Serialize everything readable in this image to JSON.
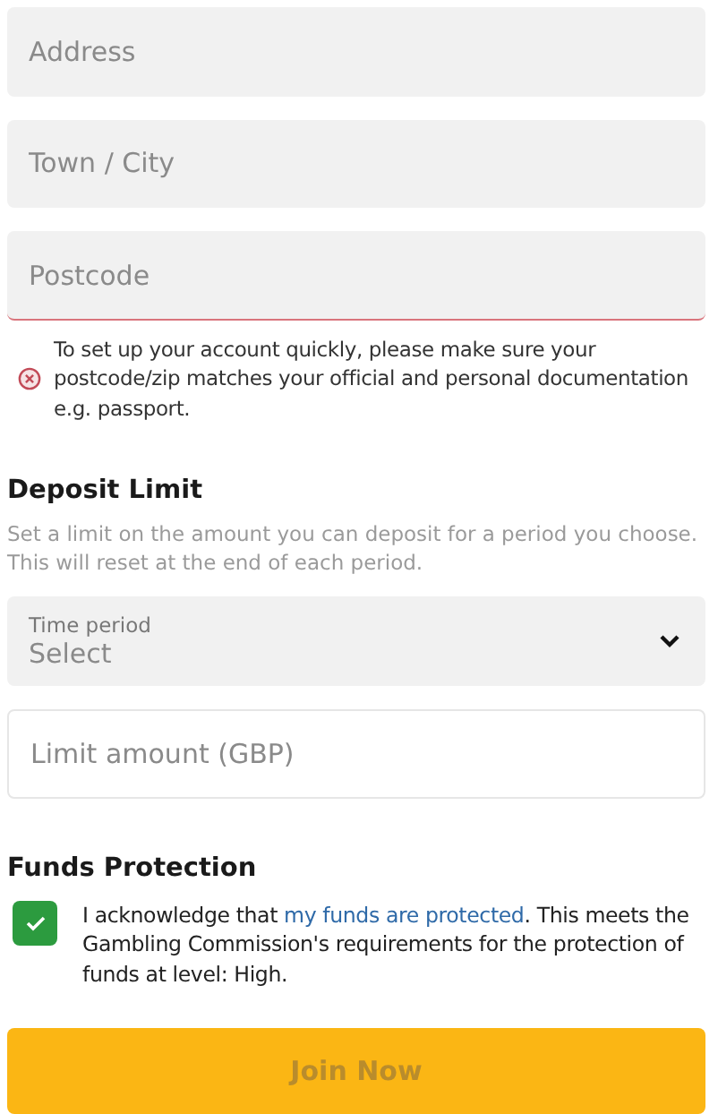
{
  "address_fields": [
    {
      "placeholder": "Address",
      "error": false
    },
    {
      "placeholder": "Town / City",
      "error": false
    },
    {
      "placeholder": "Postcode",
      "error": true
    }
  ],
  "error_message": "To set up your account quickly, please make sure your postcode/zip matches your official and personal documentation e.g. passport.",
  "deposit_limit": {
    "heading": "Deposit Limit",
    "description": "Set a limit on the amount you can deposit for a period you choose. This will reset at the end of each period.",
    "time_period": {
      "label": "Time period",
      "value": "Select"
    },
    "amount": {
      "placeholder": "Limit amount (GBP)"
    }
  },
  "funds_protection": {
    "heading": "Funds Protection",
    "checked": true,
    "text_before": "I acknowledge that ",
    "link": "my funds are protected",
    "text_after": ". This meets the Gambling Commission's requirements for the protection of funds at level: High."
  },
  "submit": {
    "label": "Join Now",
    "disabled": true
  }
}
